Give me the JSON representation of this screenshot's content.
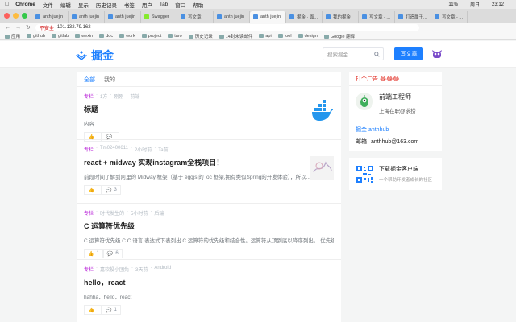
{
  "menubar": {
    "app": "Chrome",
    "items": [
      "文件",
      "编辑",
      "显示",
      "历史记录",
      "书签",
      "用户",
      "Tab",
      "窗口",
      "帮助"
    ],
    "battery": "11%",
    "day": "周日",
    "time": "23:12"
  },
  "tabs": [
    {
      "label": "anth juejin"
    },
    {
      "label": "anth juejin"
    },
    {
      "label": "anth juejin"
    },
    {
      "label": "Swagger"
    },
    {
      "label": "写文章"
    },
    {
      "label": "anth juejin"
    },
    {
      "label": "anth juejin"
    },
    {
      "label": "掘金 · 面..."
    },
    {
      "label": "我的掘金"
    },
    {
      "label": "写文章 - ..."
    },
    {
      "label": "打造属于..."
    },
    {
      "label": "写文章 - ..."
    }
  ],
  "address": {
    "warn": "不安全",
    "url": "101.132.79.162"
  },
  "bookmarks": [
    "应用",
    "github",
    "gitlab",
    "wexin",
    "doc",
    "work",
    "project",
    "taro",
    "历史记录",
    "14封未读邮件",
    "api",
    "tool",
    "design",
    "Google 翻译"
  ],
  "header": {
    "logo": "掘金",
    "search_placeholder": "搜索掘金",
    "write_label": "写文章"
  },
  "feed": {
    "tabs": [
      "全部",
      "我的"
    ],
    "items": [
      {
        "tag": "专栏",
        "author": "1方",
        "time": "刚刚",
        "category": "前端",
        "title": "标题",
        "excerpt": "内容",
        "likes": "",
        "comments": ""
      },
      {
        "tag": "专栏",
        "author": "Tm02400611",
        "time": "2小时前",
        "category": "Ta前",
        "title": "react + midway 实现instagram全栈项目！",
        "excerpt": "前段时间了解到阿里的 Midway 框架（基于 eggjs 的 ioc 框架,拥有类似Spring的开发体验），所以...",
        "likes": "",
        "comments": "3"
      },
      {
        "tag": "专栏",
        "author": "时代发生的",
        "time": "5小时前",
        "category": "后端",
        "title": "C 运算符优先级",
        "excerpt": "C 运算符优先级 C C 语言 表达式下表列出 C 运算符的优先级和结合性。运算符从顶到底以降序列出。 优先级 ...",
        "likes": "1",
        "comments": "6"
      },
      {
        "tag": "专栏",
        "author": "嘉软投小团兔",
        "time": "3天前",
        "category": "Android",
        "title": "hello，react",
        "excerpt": "hahha，hello，react",
        "likes": "",
        "comments": "1"
      }
    ]
  },
  "sidebar": {
    "ad_head": "打个广告 😂😂😂",
    "author_name": "前端工程师",
    "author_desc": "上海在职@求捞",
    "line1": "掘金 anthhub",
    "line2_label": "邮箱",
    "line2_value": "anthhub@163.com",
    "dl_title": "下载掘金客户端",
    "dl_sub": "一个帮助开发者成长的社区"
  },
  "colors": {
    "accent": "#1e80ff",
    "tag": "#b71ed7",
    "ad": "#e1251b"
  },
  "icons": [
    "search-icon",
    "like-icon",
    "comment-icon",
    "logo-icon",
    "qr-code-icon"
  ]
}
